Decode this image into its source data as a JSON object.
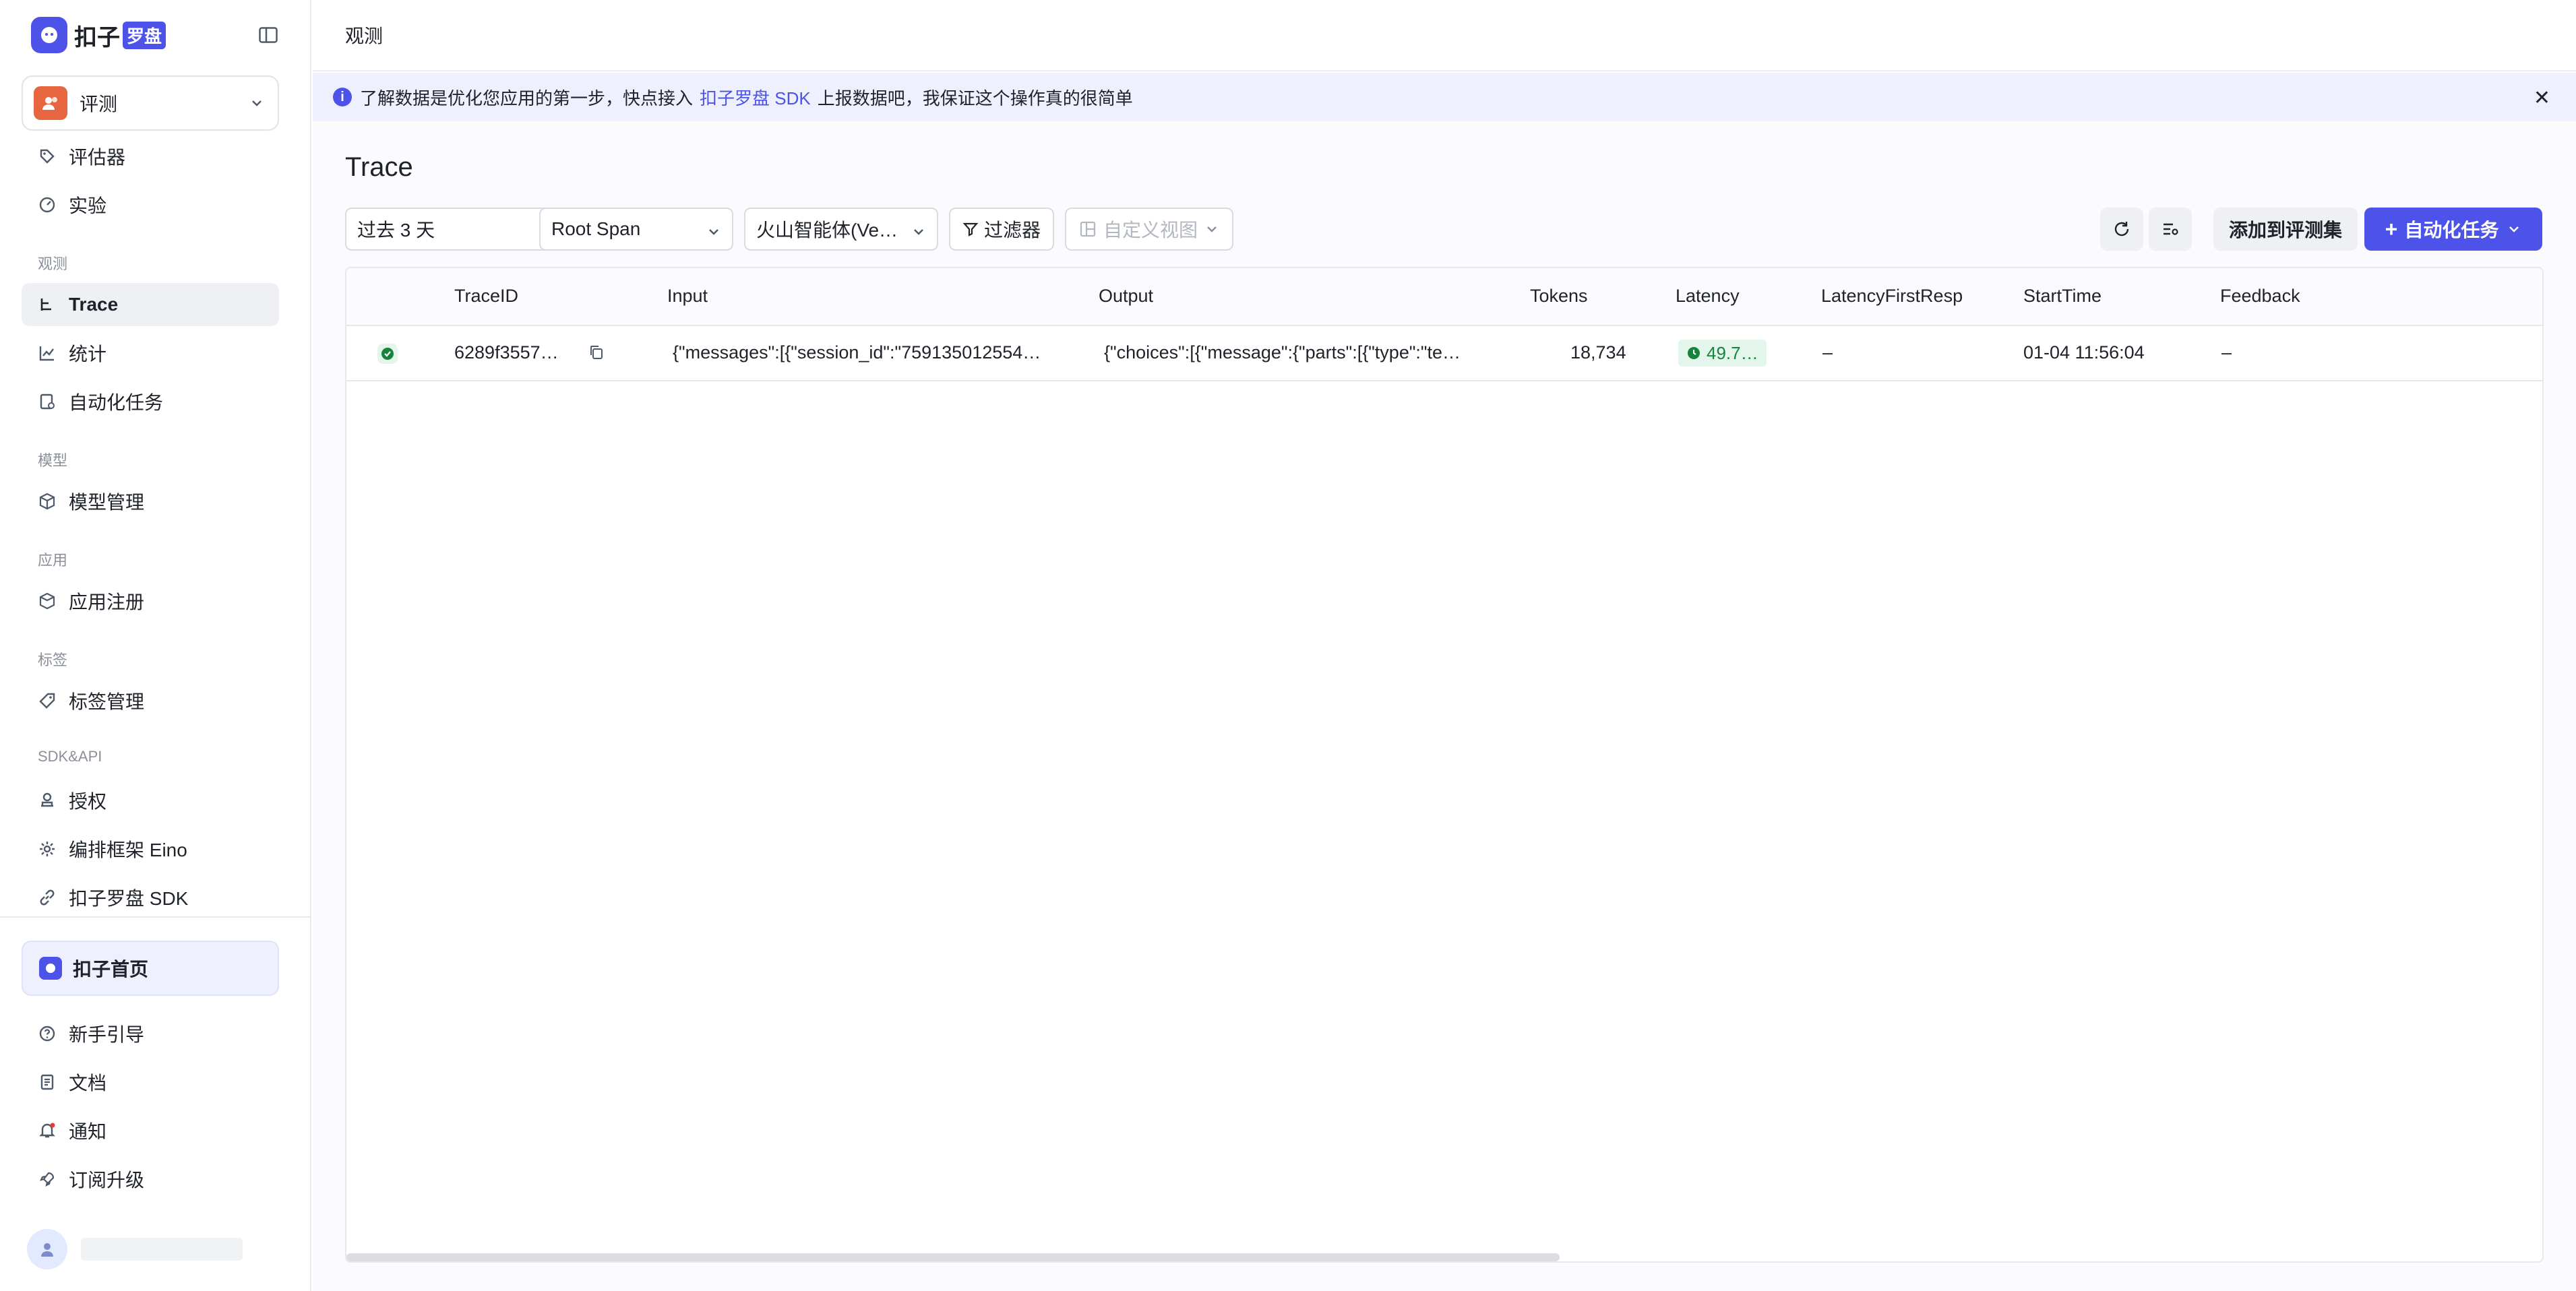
{
  "app": {
    "brand": "扣子",
    "brand_badge": "罗盘"
  },
  "workspace": {
    "name": "评测"
  },
  "sidebar": {
    "items_top": [
      {
        "label": "评估器",
        "icon": "tag-icon"
      },
      {
        "label": "实验",
        "icon": "gauge-icon"
      }
    ],
    "sections": {
      "observe": "观测",
      "model": "模型",
      "app": "应用",
      "tag": "标签",
      "sdk": "SDK&API"
    },
    "observe_items": [
      {
        "label": "Trace",
        "icon": "trace-icon",
        "active": true
      },
      {
        "label": "统计",
        "icon": "chart-icon"
      },
      {
        "label": "自动化任务",
        "icon": "task-icon"
      }
    ],
    "model_items": [
      {
        "label": "模型管理",
        "icon": "cube-icon"
      }
    ],
    "app_items": [
      {
        "label": "应用注册",
        "icon": "box-icon"
      }
    ],
    "tag_items": [
      {
        "label": "标签管理",
        "icon": "label-icon"
      }
    ],
    "sdk_items": [
      {
        "label": "授权",
        "icon": "stamp-icon"
      },
      {
        "label": "编排框架 Eino",
        "icon": "gear-icon"
      },
      {
        "label": "扣子罗盘 SDK",
        "icon": "link-icon"
      }
    ],
    "home_button": "扣子首页",
    "bottom_items": [
      {
        "label": "新手引导",
        "icon": "help-icon"
      },
      {
        "label": "文档",
        "icon": "doc-icon"
      },
      {
        "label": "通知",
        "icon": "bell-icon"
      },
      {
        "label": "订阅升级",
        "icon": "rocket-icon"
      }
    ]
  },
  "header": {
    "breadcrumb": "观测"
  },
  "banner": {
    "text_before": "了解数据是优化您应用的第一步，快点接入",
    "link": "扣子罗盘 SDK",
    "text_after": "上报数据吧，我保证这个操作真的很简单"
  },
  "page": {
    "title": "Trace"
  },
  "toolbar": {
    "time_range": "过去 3 天",
    "span_type": "Root Span",
    "platform": "火山智能体(Ve…",
    "filter_label": "过滤器",
    "view_placeholder": "自定义视图",
    "add_to_eval_label": "添加到评测集",
    "auto_task_label": "自动化任务"
  },
  "table": {
    "columns": [
      "TraceID",
      "Input",
      "Output",
      "Tokens",
      "Latency",
      "LatencyFirstResp",
      "StartTime",
      "Feedback"
    ],
    "rows": [
      {
        "status": "success",
        "trace_id": "6289f3557…",
        "input": "{\"messages\":[{\"session_id\":\"759135012554…",
        "output": "{\"choices\":[{\"message\":{\"parts\":[{\"type\":\"te…",
        "tokens": "18,734",
        "latency": "49.7…",
        "latency_first_resp": "–",
        "start_time": "01-04 11:56:04",
        "feedback": "–"
      }
    ]
  },
  "colors": {
    "brand": "#4d53e8",
    "success": "#16843c",
    "workspace_avatar": "#e8663f"
  }
}
